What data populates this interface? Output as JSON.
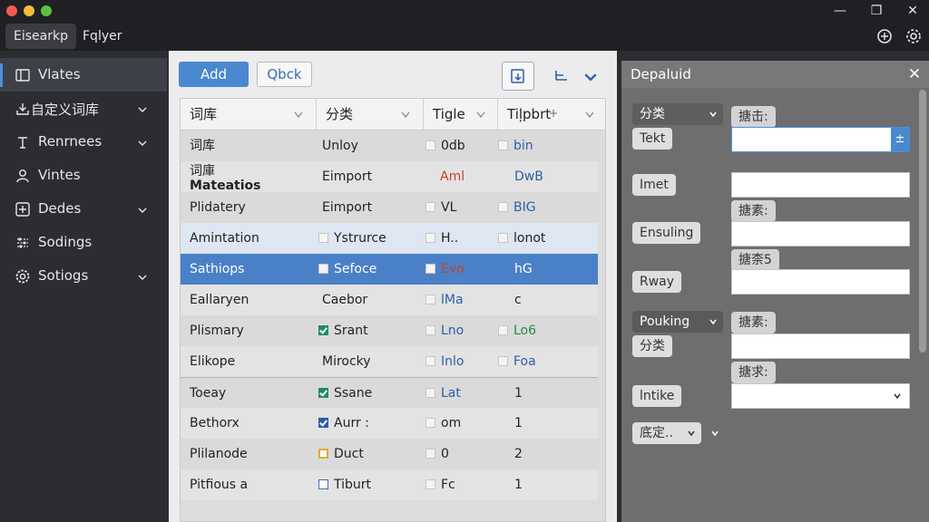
{
  "window": {
    "traffic_lights": [
      "#ee5a52",
      "#f5bd3a",
      "#5dc244"
    ],
    "controls": {
      "minimize": "—",
      "restore": "❐",
      "close": "✕"
    }
  },
  "menubar": {
    "items": [
      "Eisearkp",
      "Fqlyer"
    ],
    "icons": [
      "add-circle-icon",
      "settings-icon"
    ]
  },
  "sidebar": {
    "items": [
      {
        "label": "Vlates",
        "icon": "sidebar-toggle-icon",
        "active": true,
        "chevron": false
      },
      {
        "label": "自定义词库",
        "icon": "download-tray-icon",
        "active": false,
        "chevron": true
      },
      {
        "label": "Renrnees",
        "icon": "text-cursor-icon",
        "active": false,
        "chevron": true
      },
      {
        "label": "Vintes",
        "icon": "user-icon",
        "active": false,
        "chevron": false
      },
      {
        "label": "Dedes",
        "icon": "plus-square-icon",
        "active": false,
        "chevron": true
      },
      {
        "label": "Sodings",
        "icon": "sliders-icon",
        "active": false,
        "chevron": false
      },
      {
        "label": "Sotiogs",
        "icon": "gear-icon",
        "active": false,
        "chevron": true
      }
    ]
  },
  "toolbar": {
    "add_label": "Add",
    "qbck_label": "Qbck",
    "icons": [
      "import-box-icon",
      "sort-icon",
      "chevron-down-icon"
    ]
  },
  "table": {
    "columns": [
      "词库",
      "分类",
      "Tigle",
      "Tiļpbrt"
    ],
    "rows": [
      {
        "c1": "词库",
        "c1b": "",
        "c2": "Unloy",
        "c2cb": "",
        "c3": "0db",
        "c3cb": "empty",
        "c3color": "#222",
        "c4": "bin",
        "c4cb": "empty",
        "c4color": "#2c5fa8",
        "state": "normal"
      },
      {
        "c1": "词庫",
        "c1b": "Mateatios",
        "c2": "Eimport",
        "c2cb": "",
        "c3": "Aml",
        "c3cb": "",
        "c3color": "#c4432f",
        "c4": "DwB",
        "c4cb": "",
        "c4color": "#2c5fa8",
        "state": "normal"
      },
      {
        "c1": "Plidatery",
        "c1b": "",
        "c2": "Eimport",
        "c2cb": "",
        "c3": "VL",
        "c3cb": "empty",
        "c3color": "#222",
        "c4": "BIG",
        "c4cb": "empty",
        "c4color": "#2c5fa8",
        "state": "normal"
      },
      {
        "c1": "Amintation",
        "c1b": "",
        "c2": "Ystrurce",
        "c2cb": "empty",
        "c3": "H..",
        "c3cb": "empty",
        "c3color": "#222",
        "c4": "lonot",
        "c4cb": "empty",
        "c4color": "#222",
        "state": "hover"
      },
      {
        "c1": "Sathiops",
        "c1b": "",
        "c2": "Sefoce",
        "c2cb": "empty",
        "c3": "Evo",
        "c3cb": "empty",
        "c3color": "#c4432f",
        "c4": "hG",
        "c4cb": "",
        "c4color": "#ffffff",
        "state": "selected"
      },
      {
        "c1": "Eallaryen",
        "c1b": "",
        "c2": "Caebor",
        "c2cb": "",
        "c3": "lMa",
        "c3cb": "empty",
        "c3color": "#2c5fa8",
        "c4": "c",
        "c4cb": "",
        "c4color": "#222",
        "state": "normal"
      },
      {
        "c1": "Plismary",
        "c1b": "",
        "c2": "Srant",
        "c2cb": "checked",
        "c3": "Lno",
        "c3cb": "empty",
        "c3color": "#2c5fa8",
        "c4": "Lo6",
        "c4cb": "empty",
        "c4color": "#1f8a4c",
        "state": "normal"
      },
      {
        "c1": "Elikope",
        "c1b": "",
        "c2": "Mirocky",
        "c2cb": "",
        "c3": "Inlo",
        "c3cb": "empty",
        "c3color": "#2c5fa8",
        "c4": "Foa",
        "c4cb": "empty",
        "c4color": "#2c5fa8",
        "state": "normal"
      },
      {
        "c1": "Toeay",
        "c1b": "",
        "c2": "Ssane",
        "c2cb": "checked",
        "c3": "Lat",
        "c3cb": "empty",
        "c3color": "#2c5fa8",
        "c4": "1",
        "c4cb": "",
        "c4color": "#222",
        "state": "normal"
      },
      {
        "c1": "Bethorx",
        "c1b": "",
        "c2": "Aurr :",
        "c2cb": "blue",
        "c3": "om",
        "c3cb": "empty",
        "c3color": "#222",
        "c4": "1",
        "c4cb": "",
        "c4color": "#222",
        "state": "normal"
      },
      {
        "c1": "Plilanode",
        "c1b": "",
        "c2": "Duct",
        "c2cb": "yellow",
        "c3": "0",
        "c3cb": "empty",
        "c3color": "#222",
        "c4": "2",
        "c4cb": "",
        "c4color": "#222",
        "state": "normal"
      },
      {
        "c1": "Pitfious a",
        "c1b": "",
        "c2": "Tiburt",
        "c2cb": "outline",
        "c3": "Fc",
        "c3cb": "empty",
        "c3color": "#222",
        "c4": "1",
        "c4cb": "",
        "c4color": "#222",
        "state": "normal"
      }
    ]
  },
  "panel": {
    "title": "Depaluid",
    "close": "✕",
    "dropdown_1": "分类",
    "dropdown_2": "Pouking",
    "dropdown_3": "底定..",
    "labels": [
      "Tekt",
      "Imet",
      "Ensuling",
      "Rway",
      "分类",
      "lntike"
    ],
    "tags": [
      "搪击:",
      "搪素:",
      "搪柰5",
      "搪素:",
      "搪求:"
    ],
    "field_button": "±"
  }
}
